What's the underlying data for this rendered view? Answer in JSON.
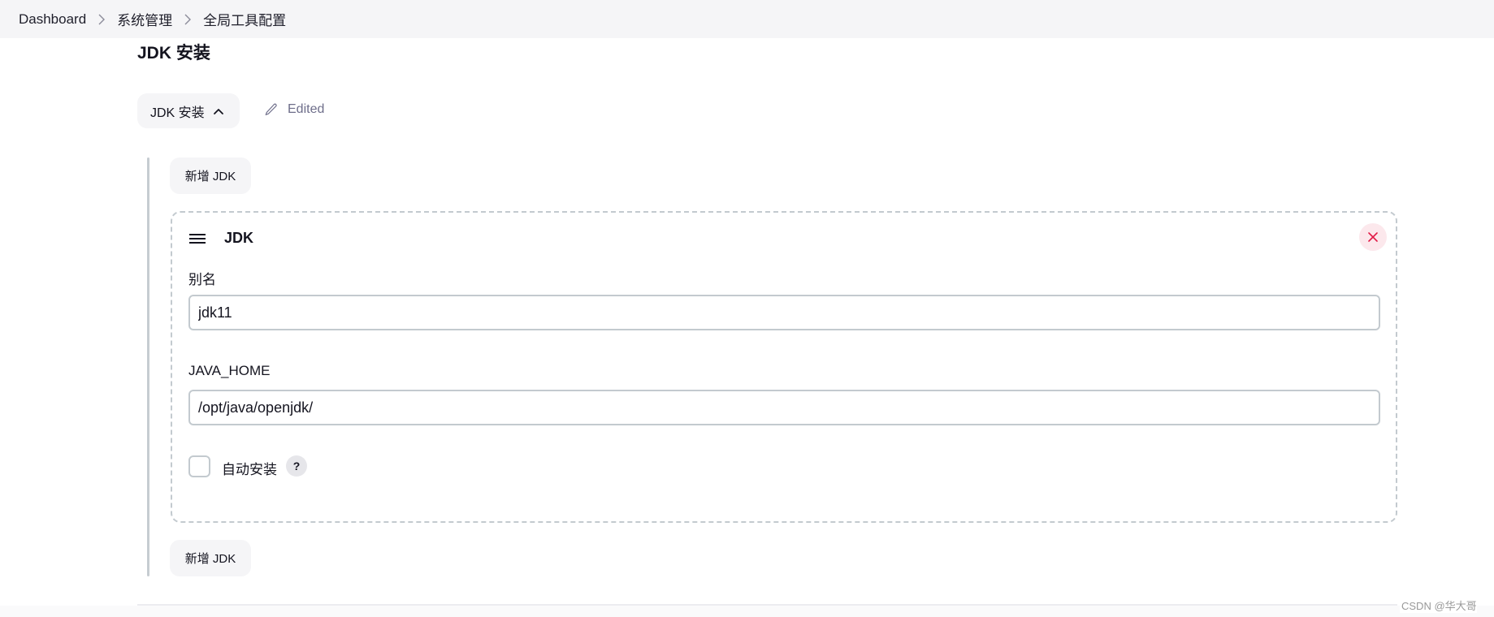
{
  "breadcrumb": {
    "items": [
      {
        "label": "Dashboard"
      },
      {
        "label": "系统管理"
      },
      {
        "label": "全局工具配置"
      }
    ],
    "separator_icon": "chevron-right-icon"
  },
  "section": {
    "heading": "JDK 安装",
    "toggle_label": "JDK 安装",
    "toggle_icon": "chevron-up-icon",
    "edited_icon": "pencil-icon",
    "edited_label": "Edited"
  },
  "actions": {
    "add_jdk_label": "新增 JDK"
  },
  "jdk_card": {
    "drag_icon": "hamburger-icon",
    "title": "JDK",
    "close_icon": "close-icon",
    "fields": {
      "alias": {
        "label": "别名",
        "value": "jdk11"
      },
      "java_home": {
        "label": "JAVA_HOME",
        "value": "/opt/java/openjdk/"
      }
    },
    "auto_install": {
      "label": "自动安装",
      "checked": false,
      "help_label": "?"
    }
  },
  "watermark": "CSDN @华大哥",
  "colors": {
    "close_accent": "#e11d48",
    "close_bg": "#fce8ec",
    "edited_text": "#6e6e8a",
    "border": "#c3cacf"
  }
}
